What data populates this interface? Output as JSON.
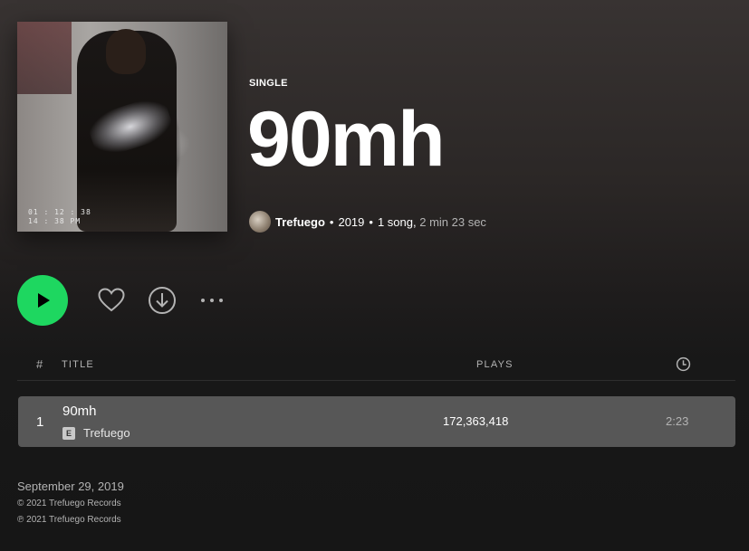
{
  "album": {
    "type_label": "SINGLE",
    "title": "90mh",
    "artist": "Trefuego",
    "year": "2019",
    "song_count": "1 song,",
    "duration": "2 min 23 sec",
    "separator": "•",
    "cover_stamp_line1": "01 : 12 : 38",
    "cover_stamp_line2": "14 : 38 PM"
  },
  "controls": {
    "play_icon": "play-icon",
    "like_icon": "heart-icon",
    "download_icon": "download-icon",
    "more_icon": "more-icon",
    "accent_color": "#1ed760"
  },
  "table": {
    "headers": {
      "number": "#",
      "title": "TITLE",
      "plays": "PLAYS",
      "duration_icon": "clock-icon"
    },
    "rows": [
      {
        "number": "1",
        "title": "90mh",
        "explicit_badge": "E",
        "artist": "Trefuego",
        "plays": "172,363,418",
        "duration": "2:23"
      }
    ]
  },
  "footer": {
    "release_date": "September 29, 2019",
    "copyright": "© 2021 Trefuego Records",
    "phonographic_copyright": "℗ 2021 Trefuego Records"
  }
}
